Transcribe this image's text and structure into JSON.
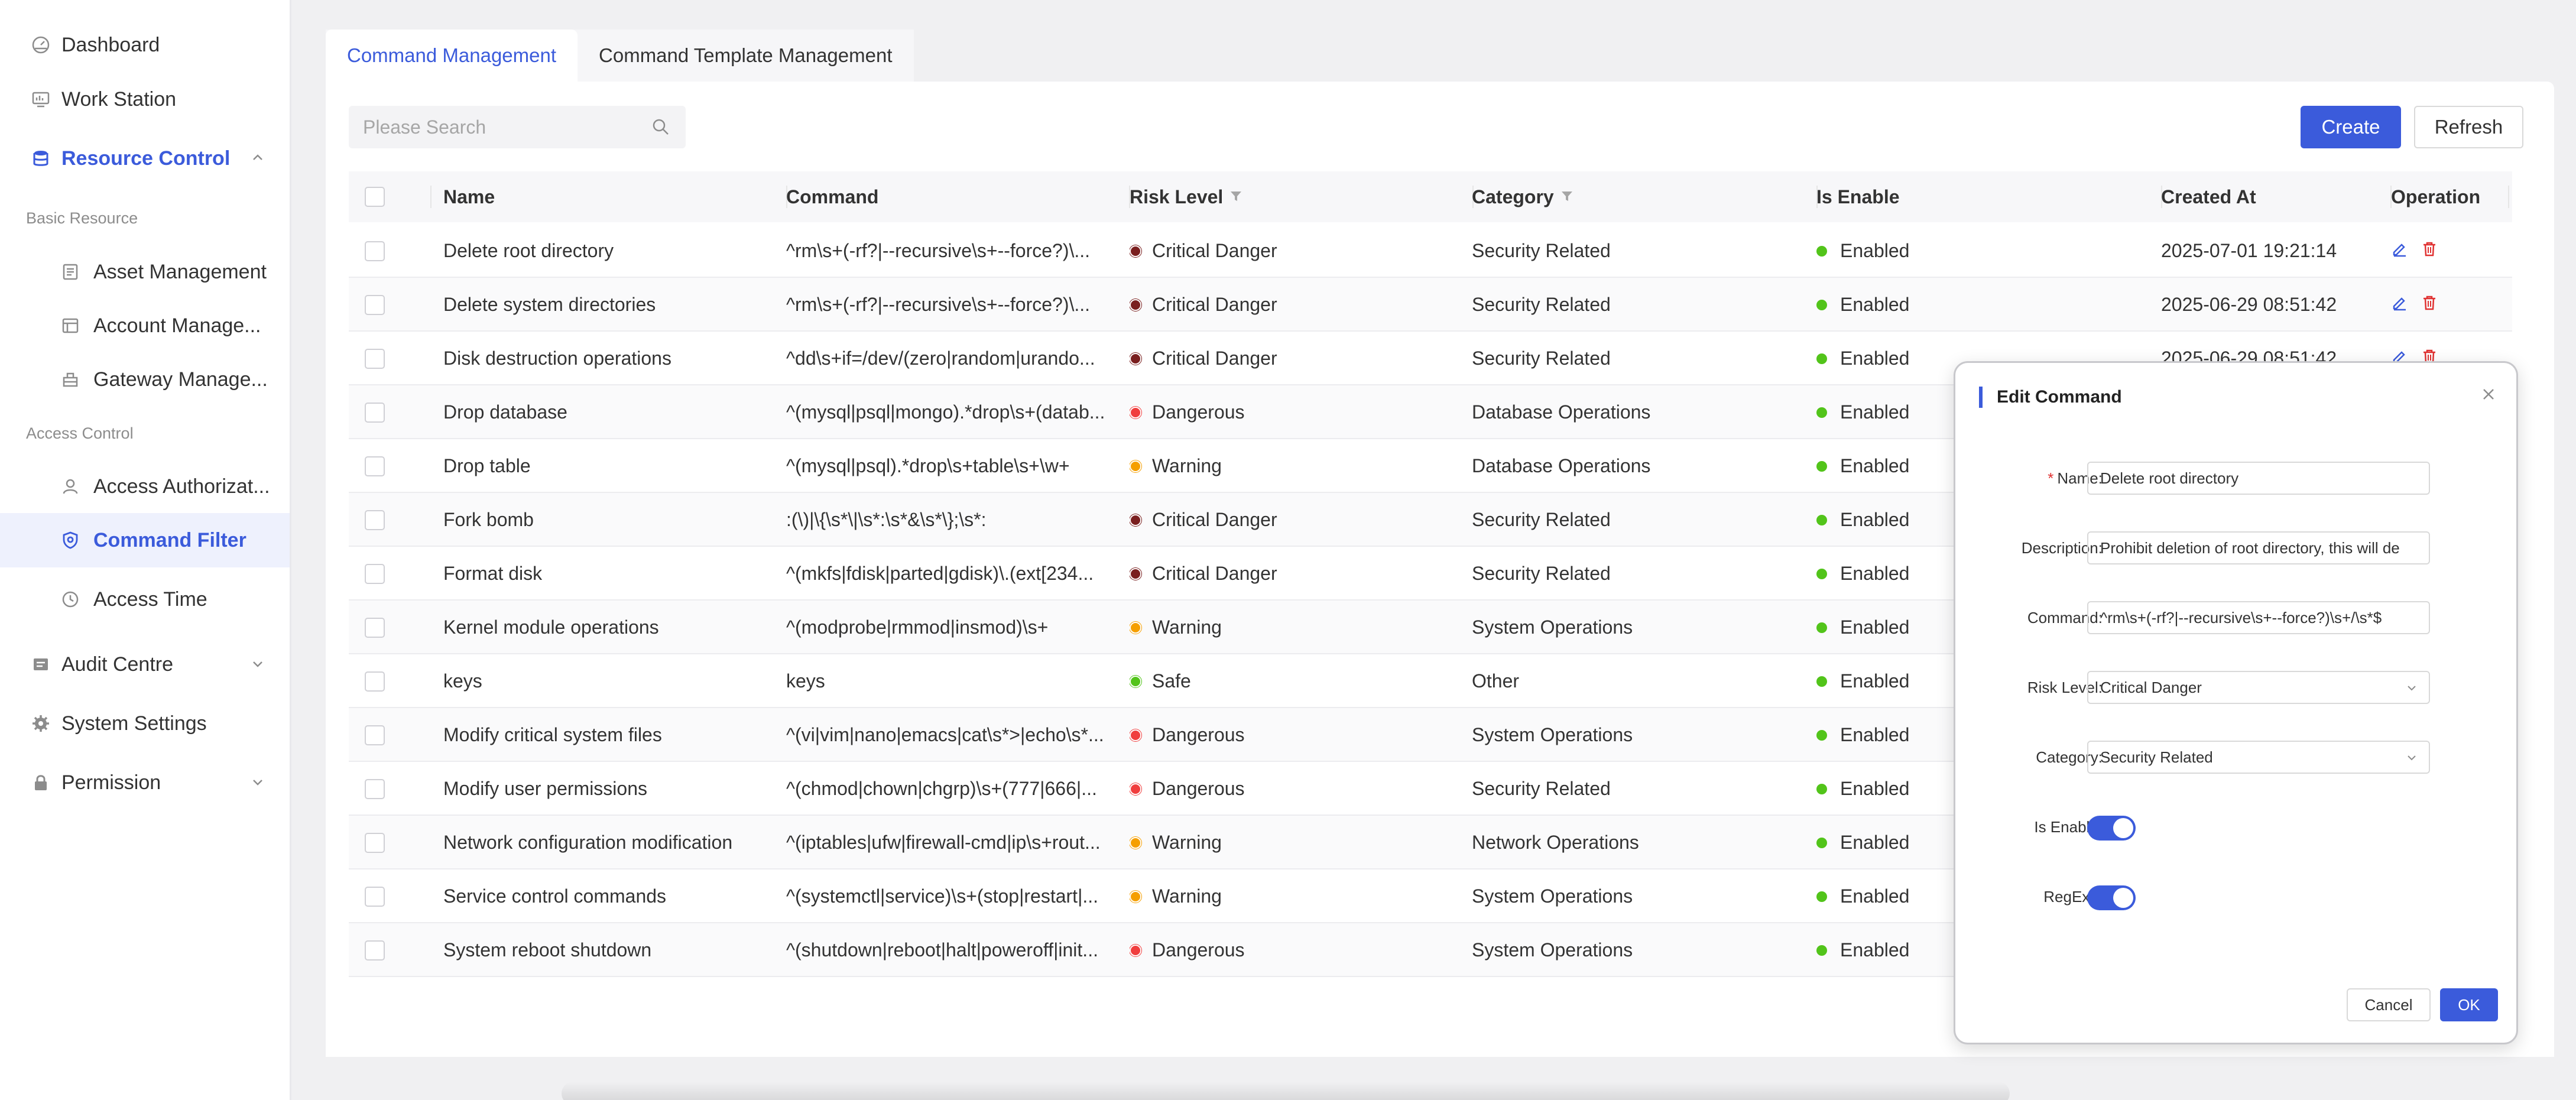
{
  "sidebar": {
    "items": [
      {
        "label": "Dashboard",
        "icon": "dashboard-icon"
      },
      {
        "label": "Work Station",
        "icon": "workstation-icon"
      },
      {
        "label": "Resource Control",
        "icon": "database-icon"
      },
      {
        "label": "Audit Centre",
        "icon": "audit-icon"
      },
      {
        "label": "System Settings",
        "icon": "gear-icon"
      },
      {
        "label": "Permission",
        "icon": "lock-icon"
      }
    ],
    "sections": {
      "basic": "Basic Resource",
      "access": "Access Control"
    },
    "sub": [
      {
        "label": "Asset Management",
        "icon": "asset-icon"
      },
      {
        "label": "Account Manage...",
        "icon": "account-icon"
      },
      {
        "label": "Gateway Manage...",
        "icon": "gateway-icon"
      },
      {
        "label": "Access Authorizat...",
        "icon": "user-icon"
      },
      {
        "label": "Command Filter",
        "icon": "shield-icon"
      },
      {
        "label": "Access Time",
        "icon": "clock-icon"
      }
    ]
  },
  "tabs": [
    "Command Management",
    "Command Template Management"
  ],
  "search": {
    "placeholder": "Please Search"
  },
  "buttons": {
    "create": "Create",
    "refresh": "Refresh"
  },
  "table": {
    "headers": [
      "Name",
      "Command",
      "Risk Level",
      "Category",
      "Is Enable",
      "Created At",
      "Operation"
    ],
    "rows": [
      {
        "name": "Delete root directory",
        "command": "^rm\\s+(-rf?|--recursive\\s+--force?)\\...",
        "risk": "Critical Danger",
        "category": "Security Related",
        "enable": "Enabled",
        "created": "2025-07-01 19:21:14"
      },
      {
        "name": "Delete system directories",
        "command": "^rm\\s+(-rf?|--recursive\\s+--force?)\\...",
        "risk": "Critical Danger",
        "category": "Security Related",
        "enable": "Enabled",
        "created": "2025-06-29 08:51:42"
      },
      {
        "name": "Disk destruction operations",
        "command": "^dd\\s+if=/dev/(zero|random|urando...",
        "risk": "Critical Danger",
        "category": "Security Related",
        "enable": "Enabled",
        "created": "2025-06-29 08:51:42"
      },
      {
        "name": "Drop database",
        "command": "^(mysql|psql|mongo).*drop\\s+(datab...",
        "risk": "Dangerous",
        "category": "Database Operations",
        "enable": "Enabled",
        "created": ""
      },
      {
        "name": "Drop table",
        "command": "^(mysql|psql).*drop\\s+table\\s+\\w+",
        "risk": "Warning",
        "category": "Database Operations",
        "enable": "Enabled",
        "created": ""
      },
      {
        "name": "Fork bomb",
        "command": ":(\\)|\\{\\s*\\|\\s*:\\s*&\\s*\\};\\s*:",
        "risk": "Critical Danger",
        "category": "Security Related",
        "enable": "Enabled",
        "created": ""
      },
      {
        "name": "Format disk",
        "command": "^(mkfs|fdisk|parted|gdisk)\\.(ext[234...",
        "risk": "Critical Danger",
        "category": "Security Related",
        "enable": "Enabled",
        "created": ""
      },
      {
        "name": "Kernel module operations",
        "command": "^(modprobe|rmmod|insmod)\\s+",
        "risk": "Warning",
        "category": "System Operations",
        "enable": "Enabled",
        "created": ""
      },
      {
        "name": "keys",
        "command": "keys",
        "risk": "Safe",
        "category": "Other",
        "enable": "Enabled",
        "created": ""
      },
      {
        "name": "Modify critical system files",
        "command": "^(vi|vim|nano|emacs|cat\\s*>|echo\\s*...",
        "risk": "Dangerous",
        "category": "System Operations",
        "enable": "Enabled",
        "created": ""
      },
      {
        "name": "Modify user permissions",
        "command": "^(chmod|chown|chgrp)\\s+(777|666|...",
        "risk": "Dangerous",
        "category": "Security Related",
        "enable": "Enabled",
        "created": ""
      },
      {
        "name": "Network configuration modification",
        "command": "^(iptables|ufw|firewall-cmd|ip\\s+rout...",
        "risk": "Warning",
        "category": "Network Operations",
        "enable": "Enabled",
        "created": ""
      },
      {
        "name": "Service control commands",
        "command": "^(systemctl|service)\\s+(stop|restart|...",
        "risk": "Warning",
        "category": "System Operations",
        "enable": "Enabled",
        "created": ""
      },
      {
        "name": "System reboot shutdown",
        "command": "^(shutdown|reboot|halt|poweroff|init...",
        "risk": "Dangerous",
        "category": "System Operations",
        "enable": "Enabled",
        "created": ""
      }
    ]
  },
  "risk_colors": {
    "Critical Danger": "#7a1f1f",
    "Dangerous": "#f03e3e",
    "Warning": "#f59f00",
    "Safe": "#52c41a"
  },
  "modal": {
    "title": "Edit Command",
    "fields": {
      "name_label": "Name",
      "name_value": "Delete root directory",
      "desc_label": "Description",
      "desc_value": "Prohibit deletion of root directory, this will de",
      "cmd_label": "Command",
      "cmd_value": "^rm\\s+(-rf?|--recursive\\s+--force?)\\s+/\\s*$",
      "risk_label": "Risk Level",
      "risk_value": "Critical Danger",
      "cat_label": "Category",
      "cat_value": "Security Related",
      "enable_label": "Is Enable",
      "regexp_label": "RegExp"
    },
    "enable_on": true,
    "regexp_on": true,
    "cancel": "Cancel",
    "ok": "OK"
  },
  "accent": "#3b5bdb"
}
